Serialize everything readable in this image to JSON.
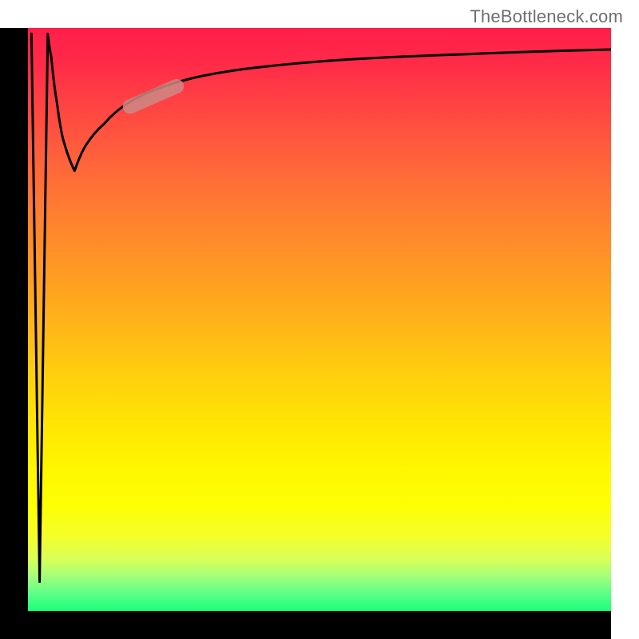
{
  "attribution": "TheBottleneck.com",
  "chart_data": {
    "type": "line",
    "title": "",
    "xlabel": "",
    "ylabel": "",
    "x_range": [
      0,
      100
    ],
    "y_range": [
      0,
      100
    ],
    "gradient_stops": [
      {
        "pos": 0.0,
        "color": "#ff1f4a"
      },
      {
        "pos": 0.2,
        "color": "#ff5a3e"
      },
      {
        "pos": 0.4,
        "color": "#ff9a24"
      },
      {
        "pos": 0.6,
        "color": "#ffd00d"
      },
      {
        "pos": 0.8,
        "color": "#fcff10"
      },
      {
        "pos": 0.95,
        "color": "#8aff7e"
      },
      {
        "pos": 1.0,
        "color": "#1aff7a"
      }
    ],
    "series": [
      {
        "name": "spike-down",
        "x": [
          0.6,
          2.0,
          3.4
        ],
        "y": [
          99.0,
          5.0,
          99.0
        ]
      },
      {
        "name": "main-curve",
        "x": [
          3.4,
          4.0,
          5.0,
          6.0,
          8.0,
          10.0,
          13.0,
          17.0,
          22.0,
          30.0,
          40.0,
          55.0,
          75.0,
          100.0
        ],
        "y": [
          99.0,
          95.0,
          87.0,
          81.0,
          75.5,
          80.0,
          83.5,
          87.0,
          89.5,
          91.8,
          93.3,
          94.6,
          95.5,
          96.3
        ]
      }
    ],
    "highlight_segment": {
      "approx_x_range": [
        17.5,
        25.5
      ],
      "approx_y_range": [
        86.5,
        90.0
      ],
      "color": "#cc8a85",
      "opacity": 0.85
    }
  }
}
